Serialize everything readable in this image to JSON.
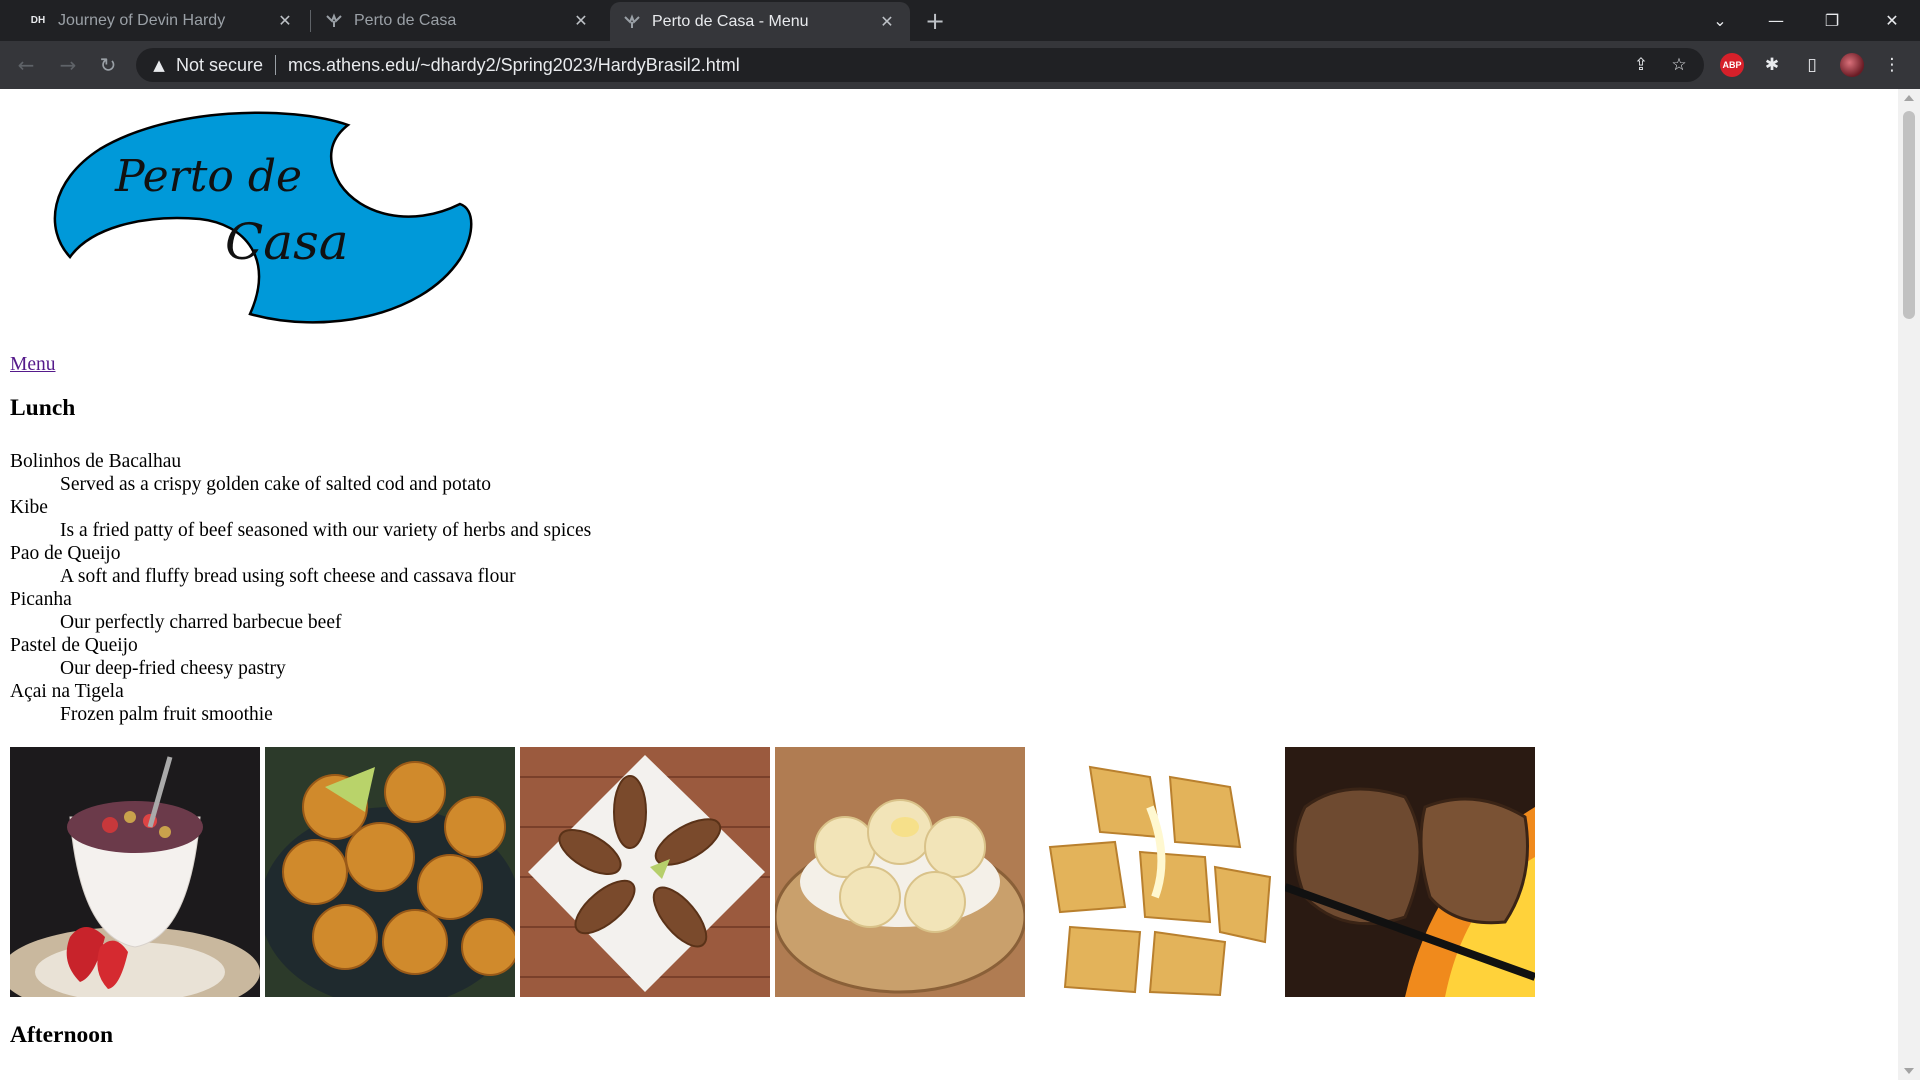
{
  "browser": {
    "tabs": [
      {
        "title": "Journey of Devin Hardy",
        "favicon_text": "DH",
        "active": false
      },
      {
        "title": "Perto de Casa",
        "active": false
      },
      {
        "title": "Perto de Casa - Menu",
        "active": true
      }
    ],
    "security_label": "Not secure",
    "url": "mcs.athens.edu/~dhardy2/Spring2023/HardyBrasil2.html",
    "extensions": {
      "adblock_label": "ABP"
    }
  },
  "page": {
    "logo": {
      "line1": "Perto de",
      "line2": "Casa",
      "fill_color": "#0099d9"
    },
    "menu_link": "Menu",
    "lunch_heading": "Lunch",
    "menu_items": [
      {
        "name": "Bolinhos de Bacalhau",
        "description": "Served as a crispy golden cake of salted cod and potato"
      },
      {
        "name": "Kibe",
        "description": "Is a fried patty of beef seasoned with our variety of herbs and spices"
      },
      {
        "name": "Pao de Queijo",
        "description": "A soft and fluffy bread using soft cheese and cassava flour"
      },
      {
        "name": "Picanha",
        "description": "Our perfectly charred barbecue beef"
      },
      {
        "name": "Pastel de Queijo",
        "description": "Our deep-fried cheesy pastry"
      },
      {
        "name": "Açai na Tigela",
        "description": "Frozen palm fruit smoothie"
      }
    ],
    "photos": [
      "acai-bowl",
      "bolinhos-de-bacalhau",
      "kibe",
      "pao-de-queijo",
      "pastel-de-queijo",
      "picanha"
    ],
    "afternoon_heading": "Afternoon"
  }
}
